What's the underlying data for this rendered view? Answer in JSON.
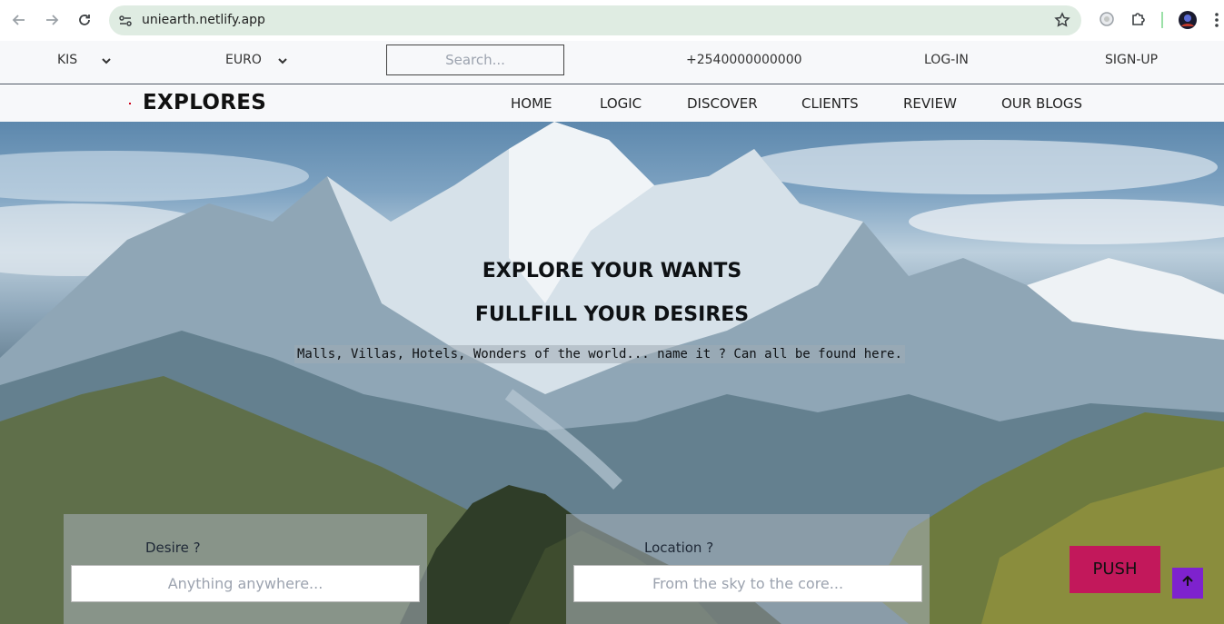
{
  "browser": {
    "url": "uniearth.netlify.app"
  },
  "utilbar": {
    "language": "KIS",
    "currency": "EURO",
    "search_placeholder": "Search...",
    "phone": "+2540000000000",
    "login": "LOG-IN",
    "signup": "SIGN-UP"
  },
  "nav": {
    "brand": "EXPLORES",
    "links": [
      "HOME",
      "LOGIC",
      "DISCOVER",
      "CLIENTS",
      "REVIEW",
      "OUR BLOGS"
    ]
  },
  "hero": {
    "title1": "EXPLORE YOUR WANTS",
    "title2": "FULLFILL YOUR DESIRES",
    "subtitle": "Malls, Villas, Hotels, Wonders of the world... name it ? Can all be found here.",
    "desire_label": "Desire ?",
    "desire_placeholder": "Anything anywhere...",
    "location_label": "Location ?",
    "location_placeholder": "From the sky to the core...",
    "push_label": "PUSH"
  },
  "colors": {
    "push_button": "#c2185b",
    "scroll_top_button": "#7e22ce",
    "omnibox": "#dfece2"
  }
}
